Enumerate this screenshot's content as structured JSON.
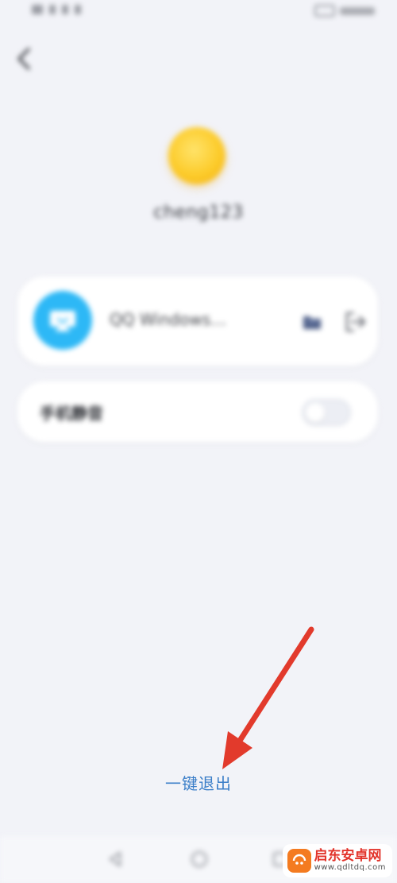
{
  "user": {
    "username": "cheng123"
  },
  "devices": [
    {
      "name": "QQ Windows…"
    }
  ],
  "settings": {
    "mute_label": "手机静音",
    "mute_enabled": false
  },
  "actions": {
    "logout_all_label": "一键退出"
  },
  "watermark": {
    "title": "启东安卓网",
    "url": "www.qdltdq.com"
  },
  "icons": {
    "back": "chevron-left-icon",
    "device": "qq-desktop-icon",
    "file": "folder-icon",
    "logout": "logout-icon",
    "arrow": "red-arrow"
  },
  "colors": {
    "background": "#f2f3f8",
    "card": "#ffffff",
    "device_icon": "#2db8f6",
    "avatar": "#fccb2a",
    "link": "#3a7ec8",
    "arrow": "#e23a2c"
  }
}
